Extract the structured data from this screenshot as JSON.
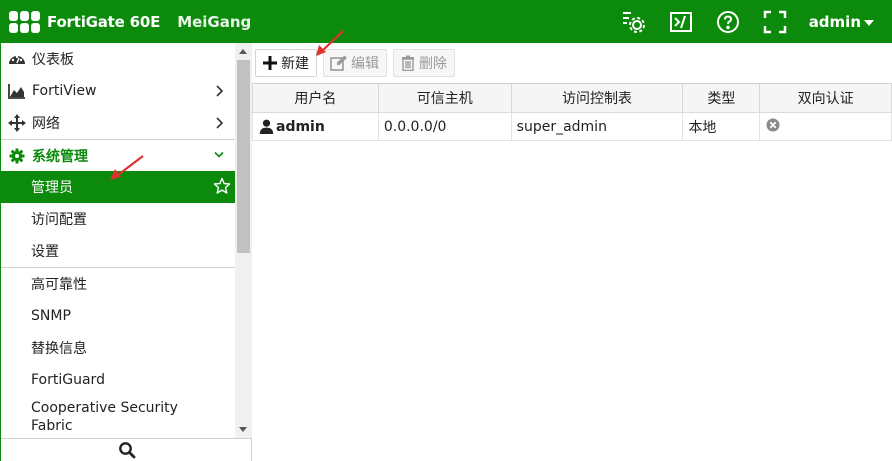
{
  "header": {
    "product": "FortiGate 60E",
    "hostname": "MeiGang",
    "user": "admin",
    "icons": [
      "settings-icon",
      "cli-icon",
      "help-icon",
      "fullscreen-icon"
    ]
  },
  "sidebar": {
    "items": [
      {
        "label": "仪表板",
        "icon": "dashboard-icon"
      },
      {
        "label": "FortiView",
        "icon": "chart-icon"
      },
      {
        "label": "网络",
        "icon": "network-icon"
      },
      {
        "label": "系统管理",
        "icon": "gear-icon"
      }
    ],
    "system_sub": [
      "管理员",
      "访问配置",
      "设置"
    ],
    "other_sub": [
      "高可靠性",
      "SNMP",
      "替换信息",
      "FortiGuard",
      "Cooperative Security Fabric"
    ]
  },
  "toolbar": {
    "new_label": "新建",
    "edit_label": "编辑",
    "delete_label": "删除"
  },
  "table": {
    "headers": [
      "用户名",
      "可信主机",
      "访问控制表",
      "类型",
      "双向认证"
    ],
    "rows": [
      {
        "username": "admin",
        "trusted_hosts": "0.0.0.0/0",
        "profile": "super_admin",
        "type": "本地",
        "two_factor": "disabled"
      }
    ]
  },
  "colors": {
    "brand": "#0b8a0b",
    "annotation_arrow": "#e03030"
  }
}
